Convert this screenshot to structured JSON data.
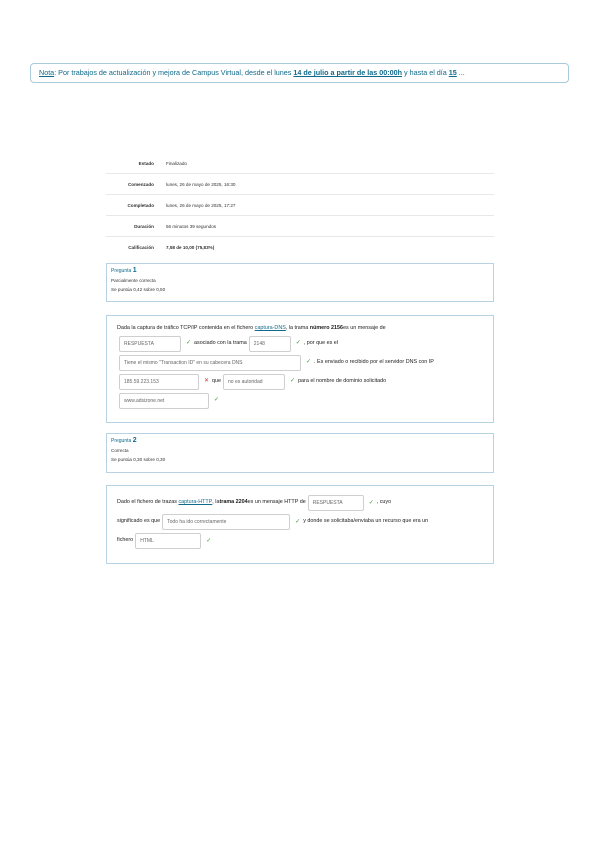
{
  "notice": {
    "label": "Nota",
    "text1": ": Por trabajos de actualización y  mejora de Campus Virtual, desde el lunes ",
    "highlight": "14 de julio a partir de las 00:00h",
    "text2": " y hasta el día ",
    "day": "15",
    "ellipsis": " ..."
  },
  "summary": [
    {
      "key": "Estado",
      "value": "Finalizado"
    },
    {
      "key": "Comenzado",
      "value": "lunes, 26 de mayo de 2025, 16:30"
    },
    {
      "key": "Completado",
      "value": "lunes, 26 de mayo de 2025, 17:27"
    },
    {
      "key": "Duración",
      "value": "56 minutos 39 segundos"
    },
    {
      "key": "Calificación",
      "value": "7,58 de 10,00 (75,83%)"
    }
  ],
  "q1": {
    "prefix": "Pregunta",
    "num": "1",
    "status": "Parcialmente correcta",
    "score": "Se puntúa 0,42 sobre 0,50",
    "t1": "Dada la captura de tráfico TCP/IP contenida en el fichero ",
    "link": "captura-DNS",
    "t2": ", la trama ",
    "bold1": "número 2156",
    "t3": " es un mensaje de",
    "f1": "RESPUESTA",
    "t4": "asociado con la trama",
    "f2": "2148",
    "t5": ", por que es el",
    "f3": "Tiene el mismo \"Transaction ID\" en su cabecera DNS",
    "t6": ". Es enviado o recibido por el servidor DNS con IP",
    "f4": "185.59.223.153",
    "t7": "que",
    "f5": "no es autoridad",
    "t8": "para el nombre de dominio solicitado",
    "f6": "www.adsizone.net"
  },
  "q2": {
    "prefix": "Pregunta",
    "num": "2",
    "status": "Correcta",
    "score": "Se puntúa 0,30 sobre 0,30",
    "t1": "Dado el fichero de trazas ",
    "link": "captura-HTTP",
    "t2": ", la ",
    "bold1": "trama 2204",
    "t3": " es un mensaje HTTP de",
    "f1": "RESPUESTA",
    "t4": ", cuyo",
    "t5": "significado es que",
    "f2": "Todo ha ido correctamente",
    "t6": "y donde se solicitaba/enviaba un recurso que era un",
    "t7": "fichero",
    "f3": "HTML"
  },
  "icons": {
    "correct": "check-icon",
    "incorrect": "cross-icon"
  },
  "colors": {
    "link": "#0f6a8b",
    "correct": "#3c9a3c",
    "incorrect": "#cc3333",
    "border": "#b7d3e3"
  }
}
